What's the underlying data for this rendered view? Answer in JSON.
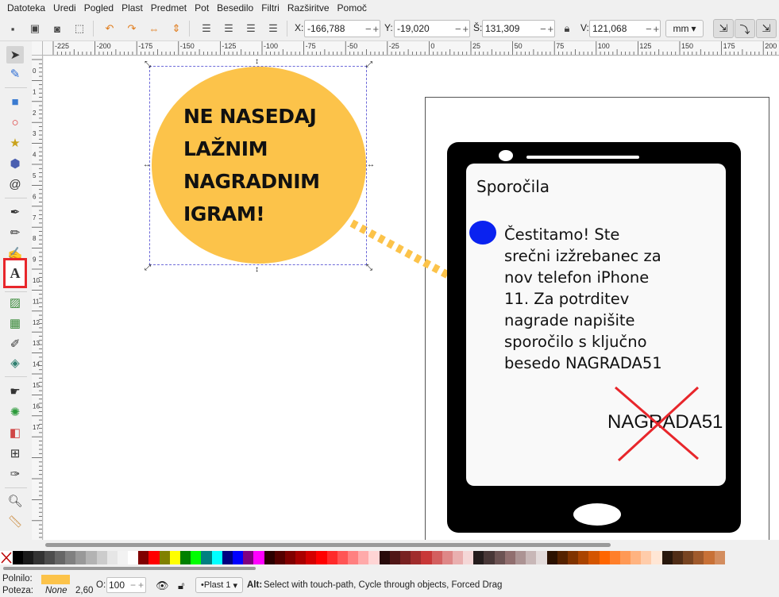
{
  "menu": [
    "Datoteka",
    "Uredi",
    "Pogled",
    "Plast",
    "Predmet",
    "Pot",
    "Besedilo",
    "Filtri",
    "Razširitve",
    "Pomoč"
  ],
  "toolbar": {
    "x_label": "X:",
    "x_value": "-166,788",
    "y_label": "Y:",
    "y_value": "-19,020",
    "w_label": "Š:",
    "w_value": "131,309",
    "h_label": "V:",
    "h_value": "121,068",
    "unit": "mm"
  },
  "ruler": {
    "top_labels": [
      "-225",
      "-200",
      "-175",
      "-150",
      "-125",
      "-100",
      "-75",
      "-50",
      "-25",
      "0",
      "25",
      "50",
      "75",
      "100",
      "125",
      "150",
      "175",
      "200"
    ],
    "left_labels": [
      "0",
      "1",
      "2",
      "3",
      "4",
      "5",
      "6",
      "7",
      "8",
      "9",
      "10",
      "11",
      "12",
      "13",
      "14",
      "15",
      "16",
      "17"
    ]
  },
  "canvas": {
    "balloon_lines": [
      "NE NASEDAJ",
      "LAŽNIM",
      "NAGRADNIM",
      "IGRAM!"
    ],
    "screen_title": "Sporočila",
    "message_lines": [
      "Čestitamo! Ste",
      "srečni izžrebanec za",
      "nov telefon iPhone",
      "11. Za potrditev",
      "nagrade napišite",
      "sporočilo s ključno",
      "besedo NAGRADA51"
    ],
    "code_word": "NAGRADA51"
  },
  "palette": [
    "#000000",
    "#1a1a1a",
    "#333333",
    "#4d4d4d",
    "#666666",
    "#808080",
    "#999999",
    "#b3b3b3",
    "#cccccc",
    "#e6e6e6",
    "#f2f2f2",
    "#ffffff",
    "#800000",
    "#ff0000",
    "#808000",
    "#ffff00",
    "#008000",
    "#00ff00",
    "#008080",
    "#00ffff",
    "#000080",
    "#0000ff",
    "#800080",
    "#ff00ff",
    "#2b0000",
    "#550000",
    "#800000",
    "#aa0000",
    "#d40000",
    "#ff0000",
    "#ff2a2a",
    "#ff5555",
    "#ff8080",
    "#ffaaaa",
    "#ffd5d5",
    "#280b0b",
    "#501616",
    "#782121",
    "#a02c2c",
    "#c83737",
    "#d35f5f",
    "#de8787",
    "#e9afaf",
    "#f4d7d7",
    "#241c1c",
    "#483737",
    "#6c5353",
    "#916f6f",
    "#ac9393",
    "#c8b7b7",
    "#e3dbdb",
    "#2b1100",
    "#552200",
    "#803300",
    "#aa4400",
    "#d45500",
    "#ff6600",
    "#ff7f2a",
    "#ff9955",
    "#ffb380",
    "#ffccaa",
    "#ffe6d5",
    "#28170b",
    "#502d16",
    "#784421",
    "#a05a2c",
    "#c87137",
    "#d38d5f"
  ],
  "status": {
    "fill_label": "Polnilo:",
    "stroke_label": "Poteza:",
    "stroke_value": "None",
    "stroke_width": "2,60",
    "opacity_label": "O:",
    "opacity_value": "100",
    "layer": "•Plast 1",
    "hint_bold": "Alt:",
    "hint": "Select with touch-path, Cycle through objects, Forced Drag"
  },
  "colors": {
    "balloon": "#fcc34a",
    "dot": "#0a22f0",
    "cross": "#e8262b",
    "highlight": "#e8262b"
  }
}
